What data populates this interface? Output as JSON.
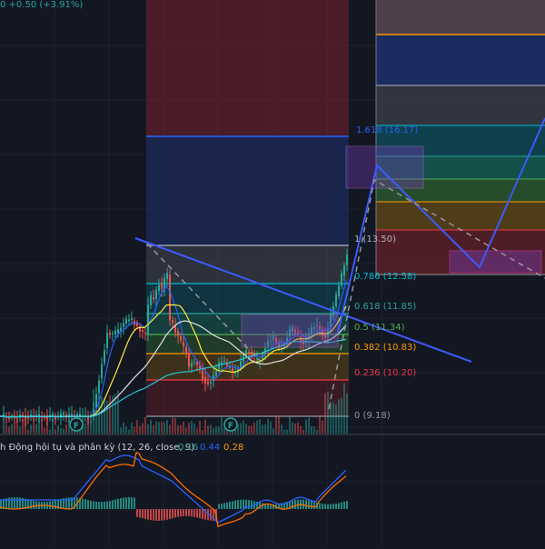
{
  "header": {
    "change_text": "0 +0.50 (+3.91%)"
  },
  "colors": {
    "up": "#26a69a",
    "down": "#ef5350",
    "trendline": "#3d5afe",
    "macd": "#2962ff",
    "signal": "#ff6d00"
  },
  "fib_levels": [
    {
      "label": "1.618 (16.17)",
      "color": "#2962ff"
    },
    {
      "label": "1 (13.50)",
      "color": "#b2b5be"
    },
    {
      "label": "0.786 (12.58)",
      "color": "#00bcd4"
    },
    {
      "label": "0.618 (11.85)",
      "color": "#26a69a"
    },
    {
      "label": "0.5 (11.34)",
      "color": "#4caf50"
    },
    {
      "label": "0.382 (10.83)",
      "color": "#ff9800"
    },
    {
      "label": "0.236 (10.20)",
      "color": "#f23645"
    },
    {
      "label": "0 (9.18)",
      "color": "#9598a1"
    }
  ],
  "markers": [
    {
      "label": "F",
      "icon": "flag-icon"
    },
    {
      "label": "F",
      "icon": "flag-icon"
    }
  ],
  "macd_legend": {
    "title": "h Động hội tụ và phân kỳ (12, 26, close, 9)",
    "hist": "0.16",
    "macd": "0.44",
    "signal": "0.28"
  }
}
